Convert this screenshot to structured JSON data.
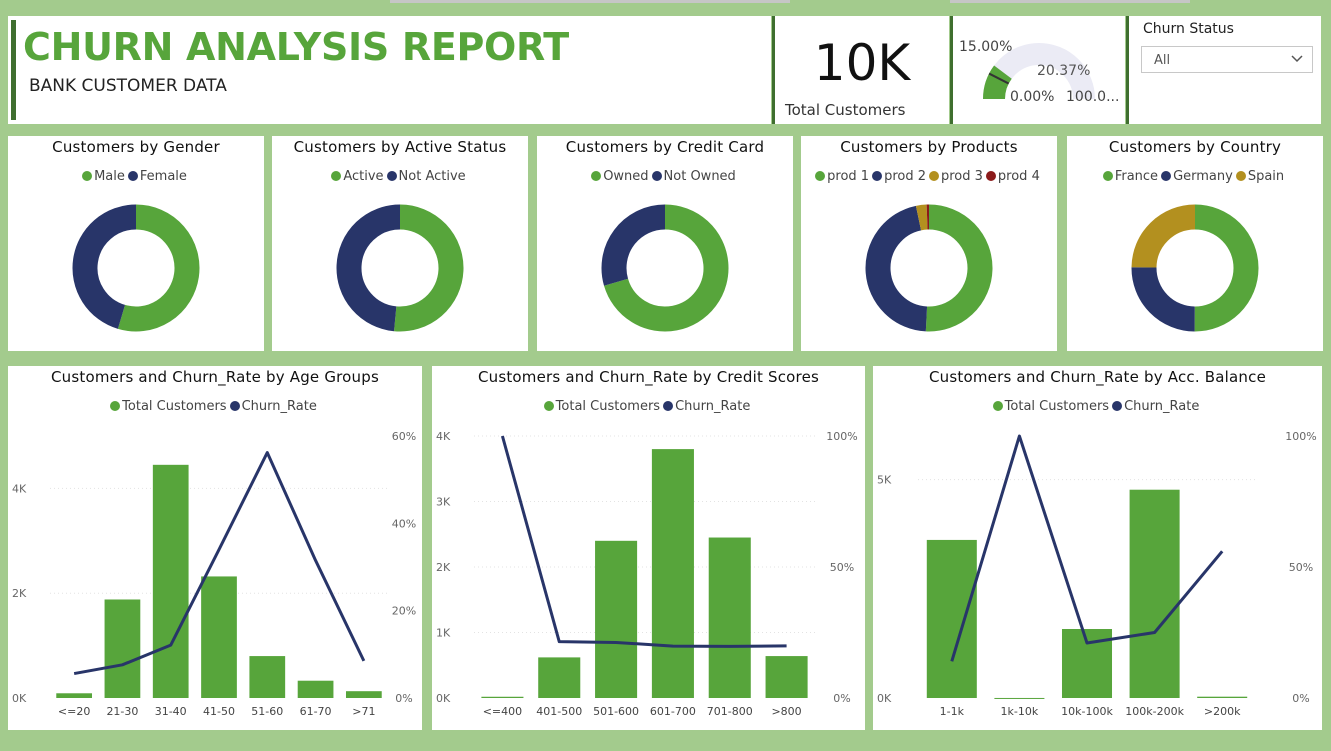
{
  "colors": {
    "green": "#57a53b",
    "navy": "#283569",
    "gold": "#b3901f",
    "darkred": "#8b1a1a",
    "gauge_bg": "#ebebf5",
    "title_green": "#57a53b"
  },
  "header": {
    "title": "CHURN ANALYSIS REPORT",
    "subtitle": "BANK CUSTOMER DATA"
  },
  "kpi": {
    "value": "10K",
    "label": "Total Customers"
  },
  "gauge": {
    "target_label": "15.00%",
    "value_label": "20.37%",
    "min_label": "0.00%",
    "max_label": "100.0...",
    "value_fraction": 0.2037,
    "target_fraction": 0.15
  },
  "filter": {
    "label": "Churn Status",
    "selected": "All"
  },
  "donuts": [
    {
      "title": "Customers by Gender",
      "legend": [
        "Male",
        "Female"
      ],
      "values": [
        54.6,
        45.4
      ],
      "colors": [
        "green",
        "navy"
      ]
    },
    {
      "title": "Customers by Active Status",
      "legend": [
        "Active",
        "Not Active"
      ],
      "values": [
        51.5,
        48.5
      ],
      "colors": [
        "green",
        "navy"
      ]
    },
    {
      "title": "Customers by Credit Card",
      "legend": [
        "Owned",
        "Not Owned"
      ],
      "values": [
        70.5,
        29.5
      ],
      "colors": [
        "green",
        "navy"
      ]
    },
    {
      "title": "Customers by Products",
      "legend": [
        "prod 1",
        "prod 2",
        "prod 3",
        "prod 4"
      ],
      "values": [
        50.8,
        45.9,
        2.7,
        0.6
      ],
      "colors": [
        "green",
        "navy",
        "gold",
        "darkred"
      ]
    },
    {
      "title": "Customers by Country",
      "legend": [
        "France",
        "Germany",
        "Spain"
      ],
      "values": [
        50.1,
        25.1,
        24.8
      ],
      "colors": [
        "green",
        "navy",
        "gold"
      ]
    }
  ],
  "combo_legend": [
    "Total Customers",
    "Churn_Rate"
  ],
  "chart_data": [
    {
      "type": "bar",
      "title": "Customers and Churn_Rate by Age Groups",
      "categories": [
        "<=20",
        "21-30",
        "31-40",
        "41-50",
        "51-60",
        "61-70",
        ">71"
      ],
      "series": [
        {
          "name": "Total Customers",
          "values": [
            90,
            1880,
            4450,
            2320,
            800,
            330,
            130
          ]
        },
        {
          "name": "Churn_Rate",
          "values": [
            5.6,
            7.6,
            12.1,
            34,
            56.2,
            31.5,
            8.5
          ]
        }
      ],
      "y_ticks": [
        "0K",
        "2K",
        "4K"
      ],
      "y2_ticks": [
        "0%",
        "20%",
        "40%",
        "60%"
      ],
      "ylim": [
        0,
        5000
      ],
      "y2lim": [
        0,
        60
      ]
    },
    {
      "type": "bar",
      "title": "Customers and Churn_Rate by Credit Scores",
      "categories": [
        "<=400",
        "401-500",
        "501-600",
        "601-700",
        "701-800",
        ">800"
      ],
      "series": [
        {
          "name": "Total Customers",
          "values": [
            19,
            620,
            2400,
            3800,
            2450,
            640
          ]
        },
        {
          "name": "Churn_Rate",
          "values": [
            100,
            21.5,
            21.2,
            19.8,
            19.7,
            19.9
          ]
        }
      ],
      "y_ticks": [
        "0K",
        "1K",
        "2K",
        "3K",
        "4K"
      ],
      "y2_ticks": [
        "0%",
        "50%",
        "100%"
      ],
      "ylim": [
        0,
        4000
      ],
      "y2lim": [
        0,
        100
      ]
    },
    {
      "type": "bar",
      "title": "Customers and Churn_Rate by Acc. Balance",
      "categories": [
        "1-1k",
        "1k-10k",
        "10k-100k",
        "100k-200k",
        ">200k"
      ],
      "series": [
        {
          "name": "Total Customers",
          "values": [
            3620,
            1,
            1580,
            4770,
            30
          ]
        },
        {
          "name": "Churn_Rate",
          "values": [
            14,
            100,
            21,
            25,
            56
          ]
        }
      ],
      "y_ticks": [
        "0K",
        "5K"
      ],
      "y2_ticks": [
        "0%",
        "50%",
        "100%"
      ],
      "ylim": [
        0,
        6000
      ],
      "y2lim": [
        0,
        100
      ]
    }
  ]
}
